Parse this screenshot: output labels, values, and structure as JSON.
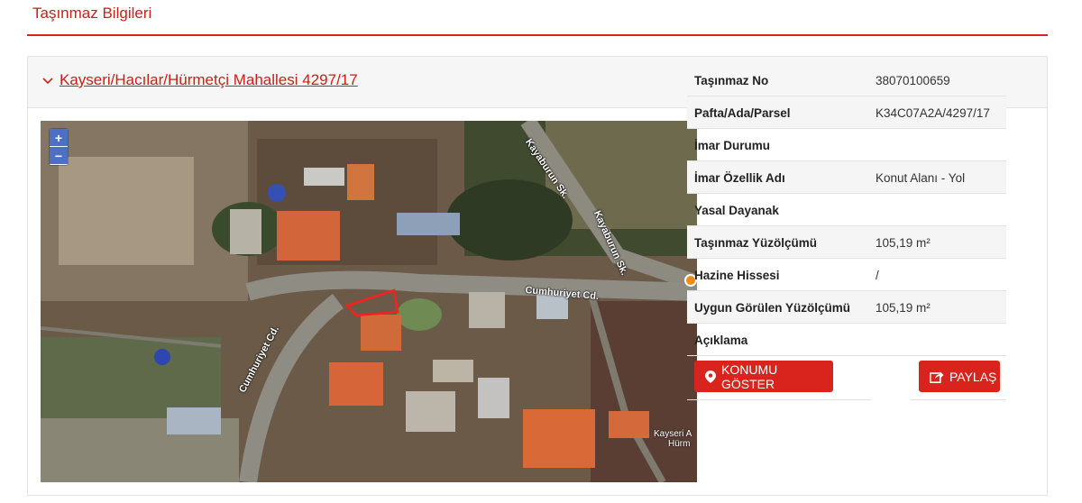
{
  "page": {
    "title": "Taşınmaz Bilgileri"
  },
  "card": {
    "title": "Kayseri/Hacılar/Hürmetçi Mahallesi 4297/17"
  },
  "map": {
    "zoom_in": "+",
    "zoom_out": "−",
    "streets": {
      "kayaburun_1": "Kayaburun Sk.",
      "kayaburun_2": "Kayaburun Sk.",
      "cumhuriyet_1": "Cumhuriyet Cd.",
      "cumhuriyet_2": "Cumhuriyet Cd."
    },
    "watermark_line1": "Kayseri A",
    "watermark_line2": "Hürm"
  },
  "info": {
    "rows": [
      {
        "label": "Taşınmaz No",
        "value": "38070100659"
      },
      {
        "label": "Pafta/Ada/Parsel",
        "value": "K34C07A2A/4297/17"
      },
      {
        "label": "İmar Durumu",
        "value": ""
      },
      {
        "label": "İmar Özellik Adı",
        "value": "Konut Alanı - Yol"
      },
      {
        "label": "Yasal Dayanak",
        "value": ""
      },
      {
        "label": "Taşınmaz Yüzölçümü",
        "value": "105,19 m²"
      },
      {
        "label": "Hazine Hissesi",
        "value": "/"
      },
      {
        "label": "Uygun Görülen Yüzölçümü",
        "value": "105,19 m²"
      },
      {
        "label": "Açıklama",
        "value": ""
      }
    ]
  },
  "buttons": {
    "locate": "KONUMU GÖSTER",
    "share": "PAYLAŞ"
  },
  "colors": {
    "accent": "#d9231d",
    "zoom": "#4d6fc5"
  }
}
